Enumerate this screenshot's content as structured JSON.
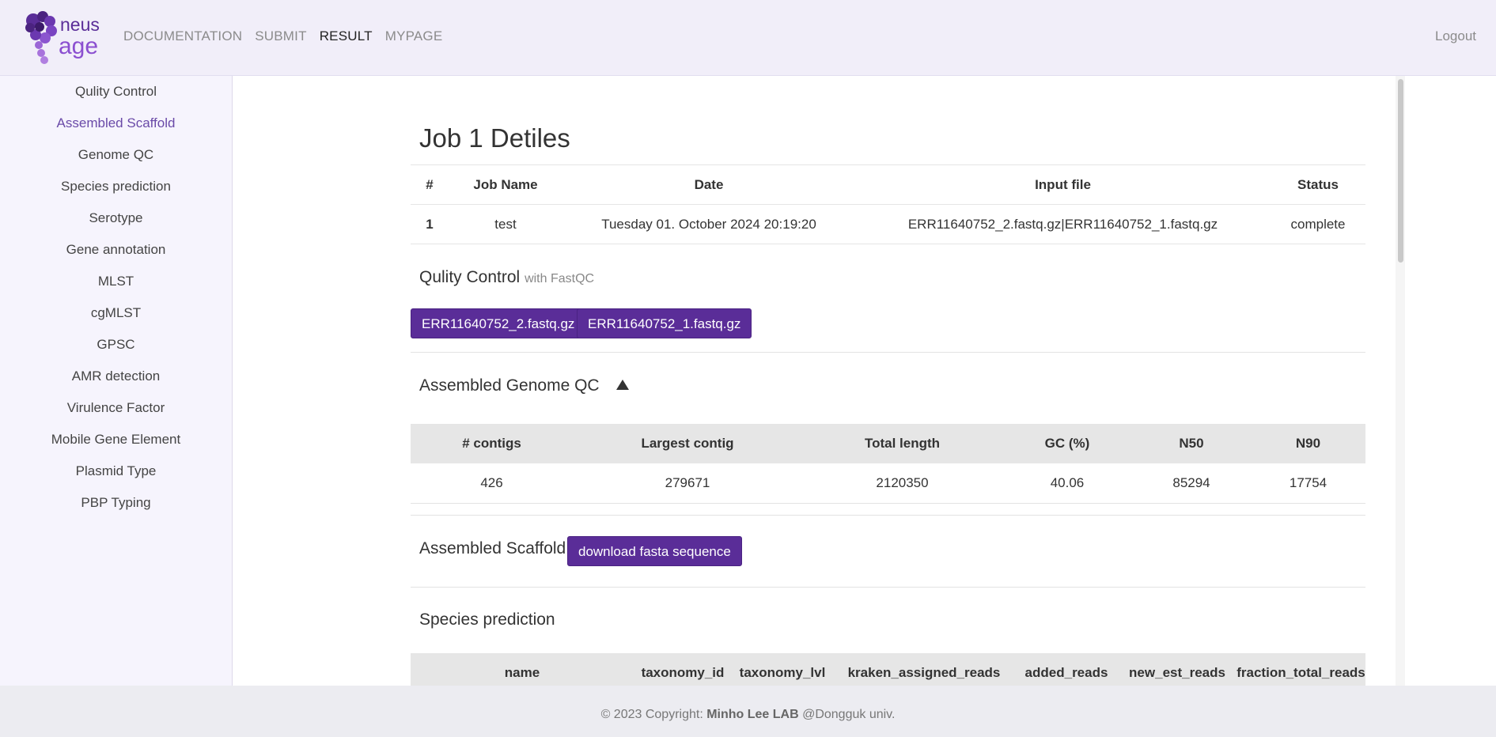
{
  "header": {
    "brand_text_1": "neus",
    "brand_text_2": "age",
    "nav": [
      "DOCUMENTATION",
      "SUBMIT",
      "RESULT",
      "MYPAGE"
    ],
    "active_nav": "RESULT",
    "logout": "Logout"
  },
  "sidebar": {
    "items": [
      "Qulity Control",
      "Assembled Scaffold",
      "Genome QC",
      "Species prediction",
      "Serotype",
      "Gene annotation",
      "MLST",
      "cgMLST",
      "GPSC",
      "AMR detection",
      "Virulence Factor",
      "Mobile Gene Element",
      "Plasmid Type",
      "PBP Typing"
    ],
    "active": "Assembled Scaffold"
  },
  "job": {
    "title": "Job 1 Detiles",
    "columns": [
      "#",
      "Job Name",
      "Date",
      "Input file",
      "Status"
    ],
    "row": [
      "1",
      "test",
      "Tuesday 01. October 2024 20:19:20",
      "ERR11640752_2.fastq.gz|ERR11640752_1.fastq.gz",
      "complete"
    ]
  },
  "quality": {
    "title": "Qulity Control",
    "subtitle": "with FastQC",
    "buttons": [
      "ERR11640752_2.fastq.gz",
      "ERR11640752_1.fastq.gz"
    ]
  },
  "genome_qc": {
    "title": "Assembled Genome QC",
    "columns": [
      "# contigs",
      "Largest contig",
      "Total length",
      "GC (%)",
      "N50",
      "N90"
    ],
    "row": [
      "426",
      "279671",
      "2120350",
      "40.06",
      "85294",
      "17754"
    ]
  },
  "scaffold": {
    "title": "Assembled Scaffold",
    "button": "download fasta sequence"
  },
  "species": {
    "title": "Species prediction",
    "columns": [
      "name",
      "taxonomy_id",
      "taxonomy_lvl",
      "kraken_assigned_reads",
      "added_reads",
      "new_est_reads",
      "fraction_total_reads"
    ]
  },
  "footer": {
    "prefix": "© 2023 Copyright: ",
    "lab": "Minho Lee LAB",
    "suffix": " @Dongguk univ."
  },
  "colors": {
    "accent": "#5a2d98",
    "header_bg": "#f1eef9",
    "sidebar_bg": "#f6f4fd",
    "active_link": "#6a4aa8"
  }
}
